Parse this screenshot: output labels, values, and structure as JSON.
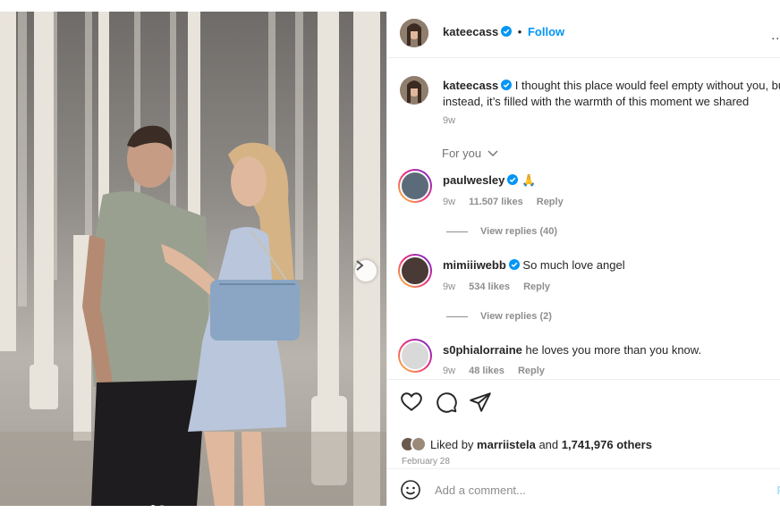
{
  "post": {
    "author": "kateecass",
    "follow_label": "Follow",
    "separator": "•",
    "more_label": "...",
    "caption_line1": "I thought this place would feel empty without you, but",
    "caption_line2": "instead, it’s filled with the warmth of this moment we shared",
    "caption_age": "9w",
    "for_you_label": "For you"
  },
  "comments": [
    {
      "user": "paulwesley",
      "text": "🙏",
      "age": "9w",
      "likes": "11.507 likes",
      "reply_label": "Reply",
      "view_replies": "View replies (40)"
    },
    {
      "user": "mimiiiwebb",
      "text": "So much love angel",
      "age": "9w",
      "likes": "534 likes",
      "reply_label": "Reply",
      "view_replies": "View replies (2)"
    },
    {
      "user": "s0phialorraine",
      "text": "he loves you more than you know.",
      "age": "9w",
      "likes": "48 likes",
      "reply_label": "Reply"
    }
  ],
  "likes_summary": {
    "prefix": "Liked by",
    "user": "marriistela",
    "and": "and",
    "others": "1,741,976 others"
  },
  "date": "February 28",
  "add_comment": {
    "placeholder": "Add a comment...",
    "post_label": "P"
  },
  "carousel": {
    "index": 1,
    "count": 2
  },
  "colors": {
    "accent": "#0095f6",
    "verified": "#0095f6",
    "muted": "#8e8e8e",
    "text": "#262626"
  },
  "icons": [
    "heart-icon",
    "comment-icon",
    "share-icon",
    "emoji-icon",
    "verified-icon",
    "chevron-down-icon",
    "chevron-right-icon"
  ]
}
